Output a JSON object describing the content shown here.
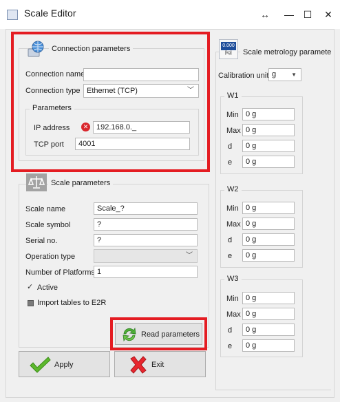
{
  "window": {
    "title": "Scale Editor",
    "restore_glyph": "↔",
    "minimize_glyph": "—",
    "maximize_glyph": "☐",
    "close_glyph": "✕"
  },
  "connection": {
    "legend": "Connection parameters",
    "name_label": "Connection name",
    "name_value": "",
    "type_label": "Connection type",
    "type_value": "Ethernet (TCP)",
    "params_legend": "Parameters",
    "ip_label": "IP address",
    "ip_value": "192.168.0._",
    "port_label": "TCP port",
    "port_value": "4001"
  },
  "scale": {
    "legend": "Scale parameters",
    "name_label": "Scale name",
    "name_value": "Scale_?",
    "symbol_label": "Scale symbol",
    "symbol_value": "?",
    "serial_label": "Serial no.",
    "serial_value": "?",
    "optype_label": "Operation type",
    "optype_value": "",
    "platforms_label": "Number of Platforms",
    "platforms_value": "1",
    "active_label": "Active",
    "active_checked": true,
    "import_label": "Import tables to E2R",
    "import_checked": false
  },
  "buttons": {
    "read": "Read parameters",
    "apply": "Apply",
    "exit": "Exit"
  },
  "metrology": {
    "legend": "Scale metrology paramete",
    "icon_text": "0.000",
    "icon_subtext": "[kg]",
    "calib_label": "Calibration unit",
    "calib_value": "g",
    "groups": [
      {
        "legend": "W1",
        "min_label": "Min",
        "min": "0 g",
        "max_label": "Max",
        "max": "0 g",
        "d_label": "d",
        "d": "0 g",
        "e_label": "e",
        "e": "0 g"
      },
      {
        "legend": "W2",
        "min_label": "Min",
        "min": "0 g",
        "max_label": "Max",
        "max": "0 g",
        "d_label": "d",
        "d": "0 g",
        "e_label": "e",
        "e": "0 g"
      },
      {
        "legend": "W3",
        "min_label": "Min",
        "min": "0 g",
        "max_label": "Max",
        "max": "0 g",
        "d_label": "d",
        "d": "0 g",
        "e_label": "e",
        "e": "0 g"
      }
    ]
  },
  "colors": {
    "highlight": "#e41c22",
    "window_bg": "#f0f0f0",
    "check_green": "#5cb82c",
    "exit_red": "#e8262e"
  }
}
